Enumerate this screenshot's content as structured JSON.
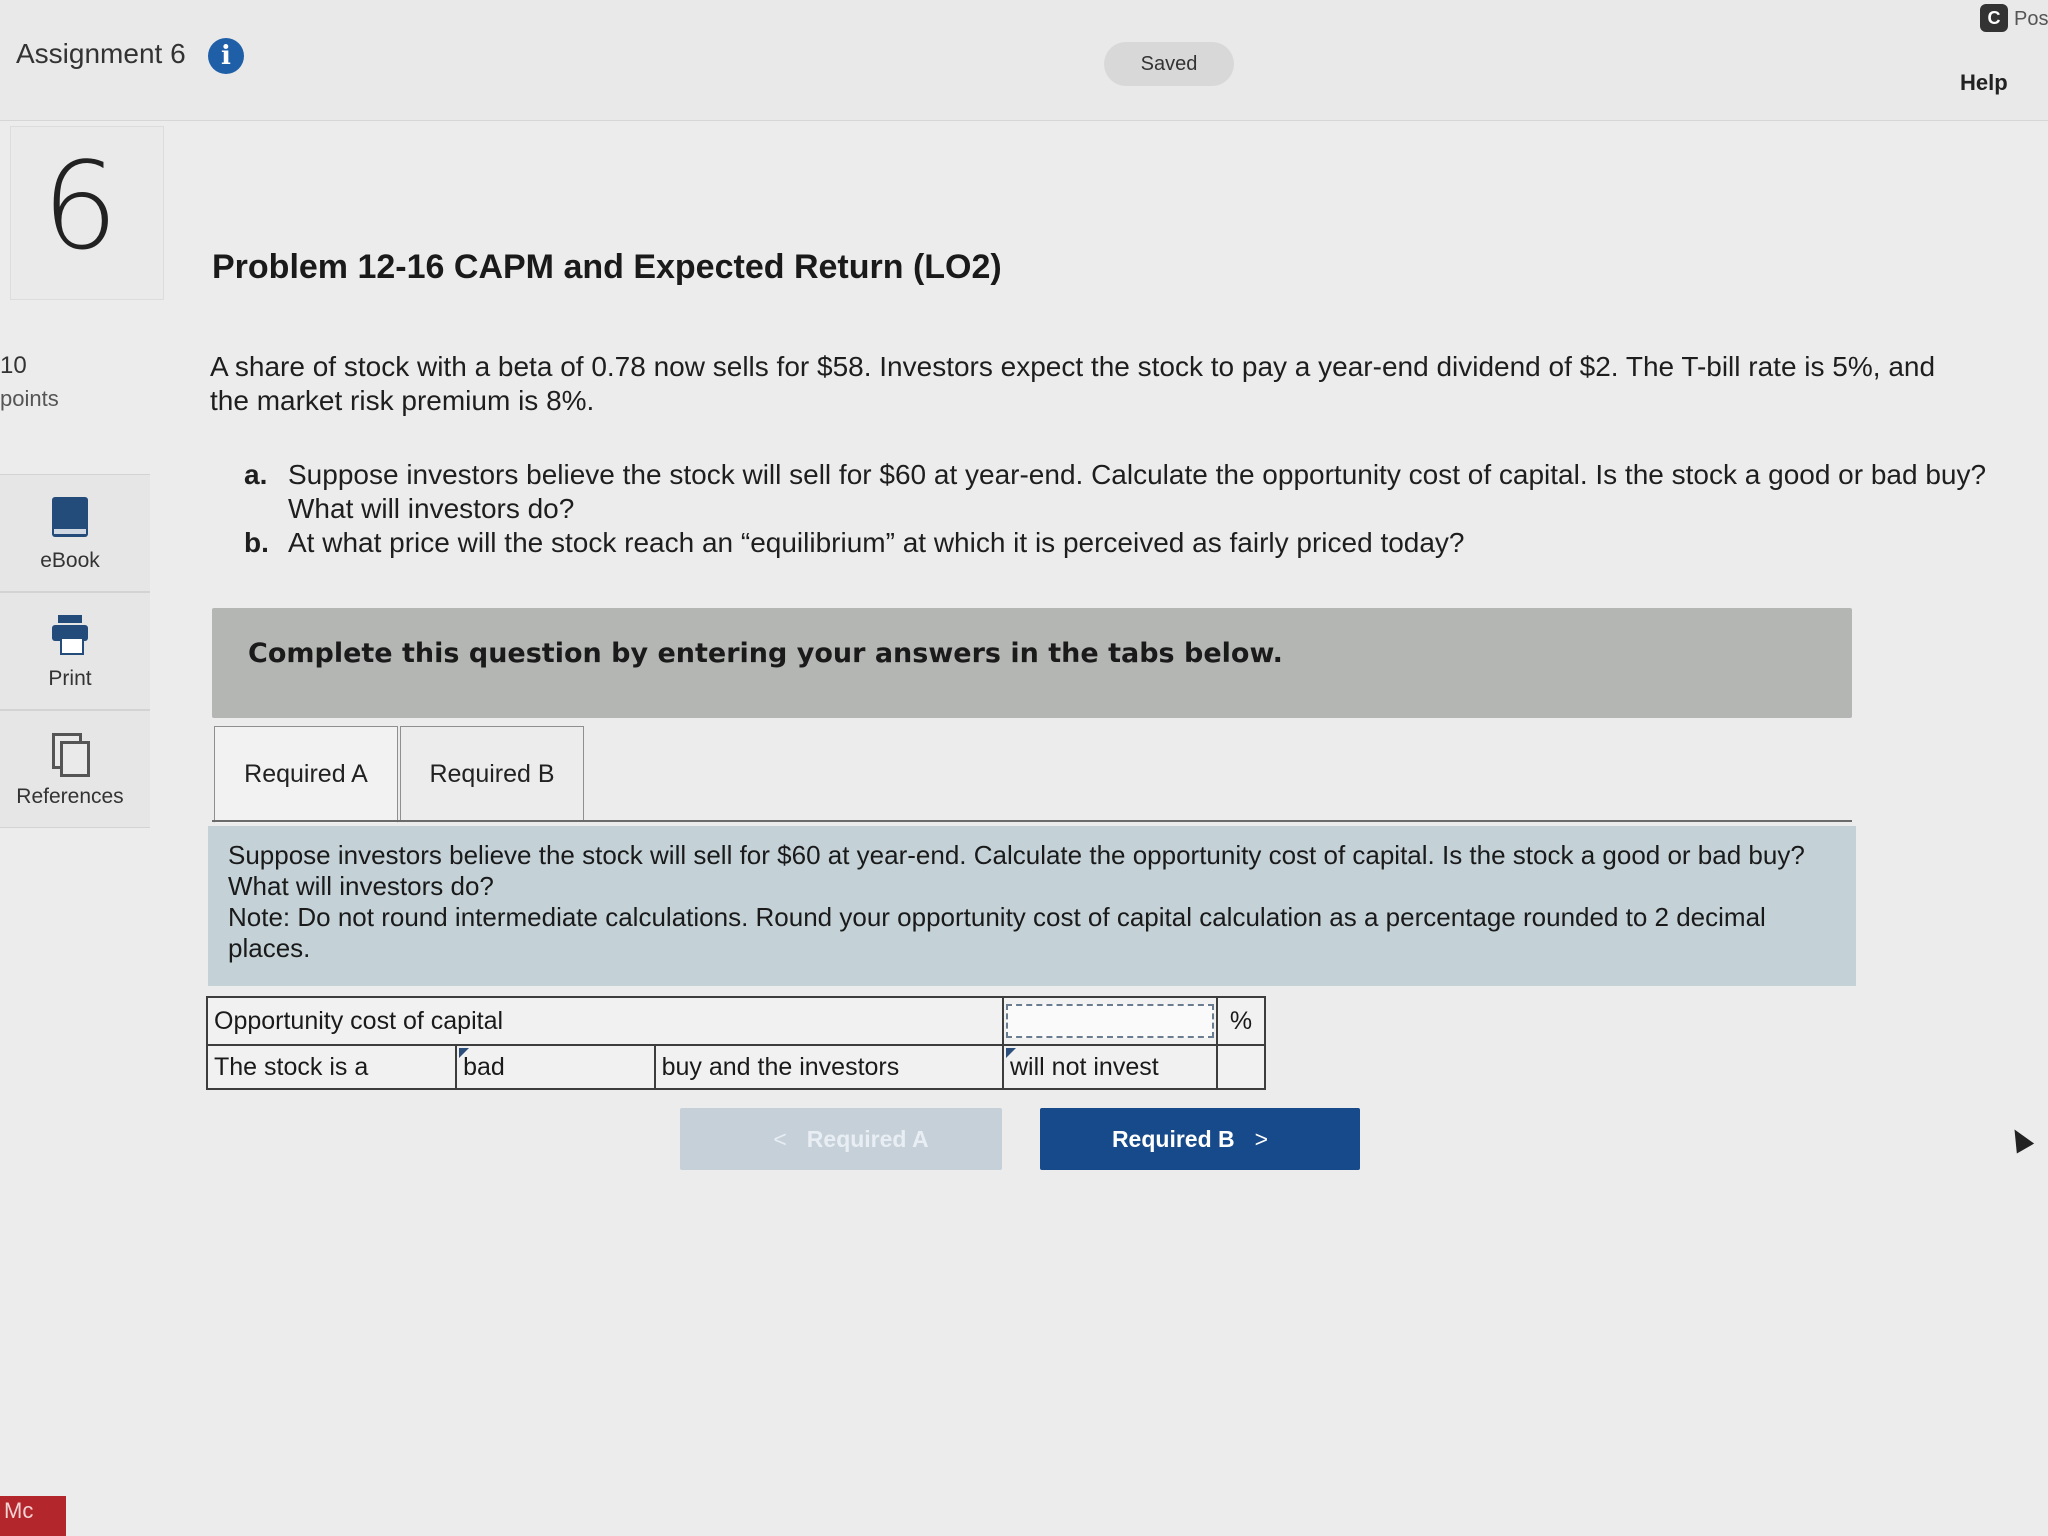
{
  "header": {
    "assignment_title": "Assignment 6",
    "info_icon": "i",
    "saved_status": "Saved",
    "help_label": "Help",
    "pos_badge": "C",
    "pos_text": "Pos"
  },
  "question": {
    "number": "6",
    "points_value": "10",
    "points_label": "points",
    "title": "Problem 12-16 CAPM and Expected Return (LO2)",
    "intro": "A share of stock with a beta of 0.78 now sells for $58. Investors expect the stock to pay a year-end dividend of $2. The T-bill rate is 5%, and the market risk premium is 8%.",
    "parts": [
      {
        "letter": "a.",
        "text": "Suppose investors believe the stock will sell for $60 at year-end. Calculate the opportunity cost of capital. Is the stock a good or bad buy? What will investors do?"
      },
      {
        "letter": "b.",
        "text": "At what price will the stock reach an “equilibrium” at which it is perceived as fairly priced today?"
      }
    ]
  },
  "sidebar": {
    "tools": [
      {
        "label": "eBook",
        "icon": "book-icon"
      },
      {
        "label": "Print",
        "icon": "printer-icon"
      },
      {
        "label": "References",
        "icon": "copy-icon"
      }
    ]
  },
  "instructions": "Complete this question by entering your answers in the tabs below.",
  "tabs": [
    {
      "label": "Required A",
      "active": true
    },
    {
      "label": "Required B",
      "active": false
    }
  ],
  "panel": {
    "prompt": "Suppose investors believe the stock will sell for $60 at year-end. Calculate the opportunity cost of capital. Is the stock a good or bad buy? What will investors do?",
    "note": "Note: Do not round intermediate calculations. Round your opportunity cost of capital calculation as a percentage rounded to 2 decimal places."
  },
  "answer_table": {
    "row1_label": "Opportunity cost of capital",
    "row1_value": "",
    "row1_unit": "%",
    "row2_label": "The stock is a",
    "row2_select": "bad",
    "row2_middle": "buy and the investors",
    "row2_select2": "will not invest"
  },
  "nav": {
    "prev_label": "Required A",
    "next_label": "Required B",
    "prev_chevron": "<",
    "next_chevron": ">"
  },
  "footer": {
    "logo_text": "Mc"
  }
}
